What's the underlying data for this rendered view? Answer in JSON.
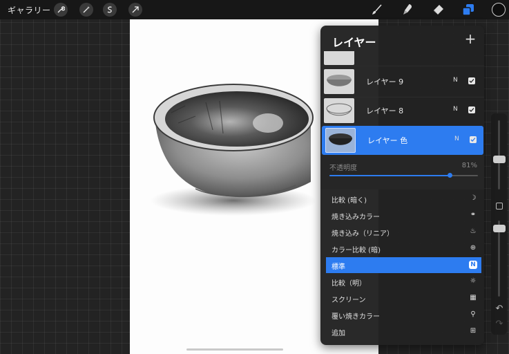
{
  "topbar": {
    "gallery_label": "ギャラリー",
    "left_tools": [
      "wrench-icon",
      "magic-wand-icon",
      "selection-icon",
      "transform-arrow-icon"
    ],
    "right_tools": [
      "brush-icon",
      "smudge-icon",
      "eraser-icon",
      "layers-icon"
    ],
    "current_color": "#0e0e0e"
  },
  "panel": {
    "title": "レイヤー",
    "add_label": "+",
    "layers": [
      {
        "name": "レイヤー 9",
        "mode": "N",
        "visible": true
      },
      {
        "name": "レイヤー 8",
        "mode": "N",
        "visible": true
      },
      {
        "name": "レイヤー 色",
        "mode": "N",
        "visible": true,
        "active": true
      }
    ],
    "opacity": {
      "label": "不透明度",
      "value": "81%",
      "fraction": 0.81
    },
    "blend_modes": [
      {
        "label": "比較 (暗く)",
        "icon": "moon-icon"
      },
      {
        "label": "焼き込みカラー",
        "icon": "burn-icon"
      },
      {
        "label": "焼き込み（リニア）",
        "icon": "flame-icon"
      },
      {
        "label": "カラー比較 (暗)",
        "icon": "plus-circle-icon"
      },
      {
        "label": "標準",
        "icon": "N",
        "selected": true
      },
      {
        "label": "比較（明）",
        "icon": "sun-icon"
      },
      {
        "label": "スクリーン",
        "icon": "hatch-icon"
      },
      {
        "label": "覆い焼きカラー",
        "icon": "search-icon"
      },
      {
        "label": "追加",
        "icon": "plus-square-icon"
      }
    ]
  },
  "accent_color": "#2d7cf0"
}
